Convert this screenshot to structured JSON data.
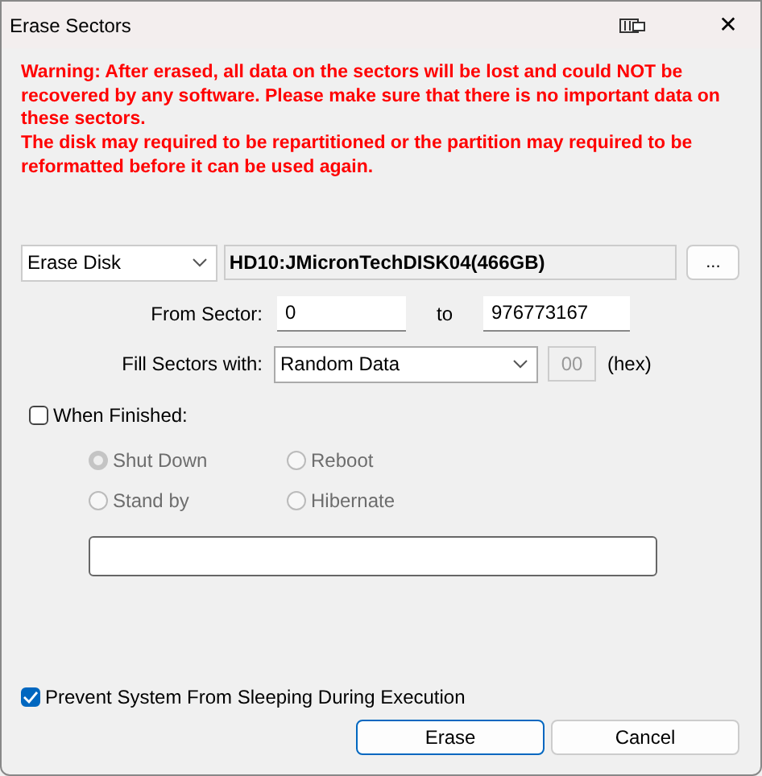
{
  "window": {
    "title": "Erase Sectors",
    "close": "✕"
  },
  "warning": [
    "Warning: After erased, all data on the sectors will be lost and could NOT be recovered by any software. Please make sure that there is no important data on these sectors.",
    "The disk may required to be repartitioned or the partition may required to be reformatted before it can be used again."
  ],
  "target": {
    "mode": "Erase Disk",
    "disk": "HD10:JMicronTechDISK04(466GB)",
    "browse": "..."
  },
  "range": {
    "label": "From Sector:",
    "from": "0",
    "to_label": "to",
    "to": "976773167"
  },
  "fill": {
    "label": "Fill Sectors with:",
    "value": "Random Data",
    "hex": "00",
    "hex_label": "(hex)"
  },
  "when_finished": {
    "label": "When Finished:",
    "checked": false,
    "options": [
      {
        "label": "Shut Down",
        "selected": true,
        "disabled": true
      },
      {
        "label": "Reboot",
        "selected": false,
        "disabled": true
      },
      {
        "label": "Stand by",
        "selected": false,
        "disabled": true
      },
      {
        "label": "Hibernate",
        "selected": false,
        "disabled": true
      }
    ]
  },
  "prevent_sleep": {
    "label": "Prevent System From Sleeping During Execution",
    "checked": true
  },
  "buttons": [
    {
      "label": "Erase",
      "default": true
    },
    {
      "label": "Cancel",
      "default": false
    }
  ]
}
